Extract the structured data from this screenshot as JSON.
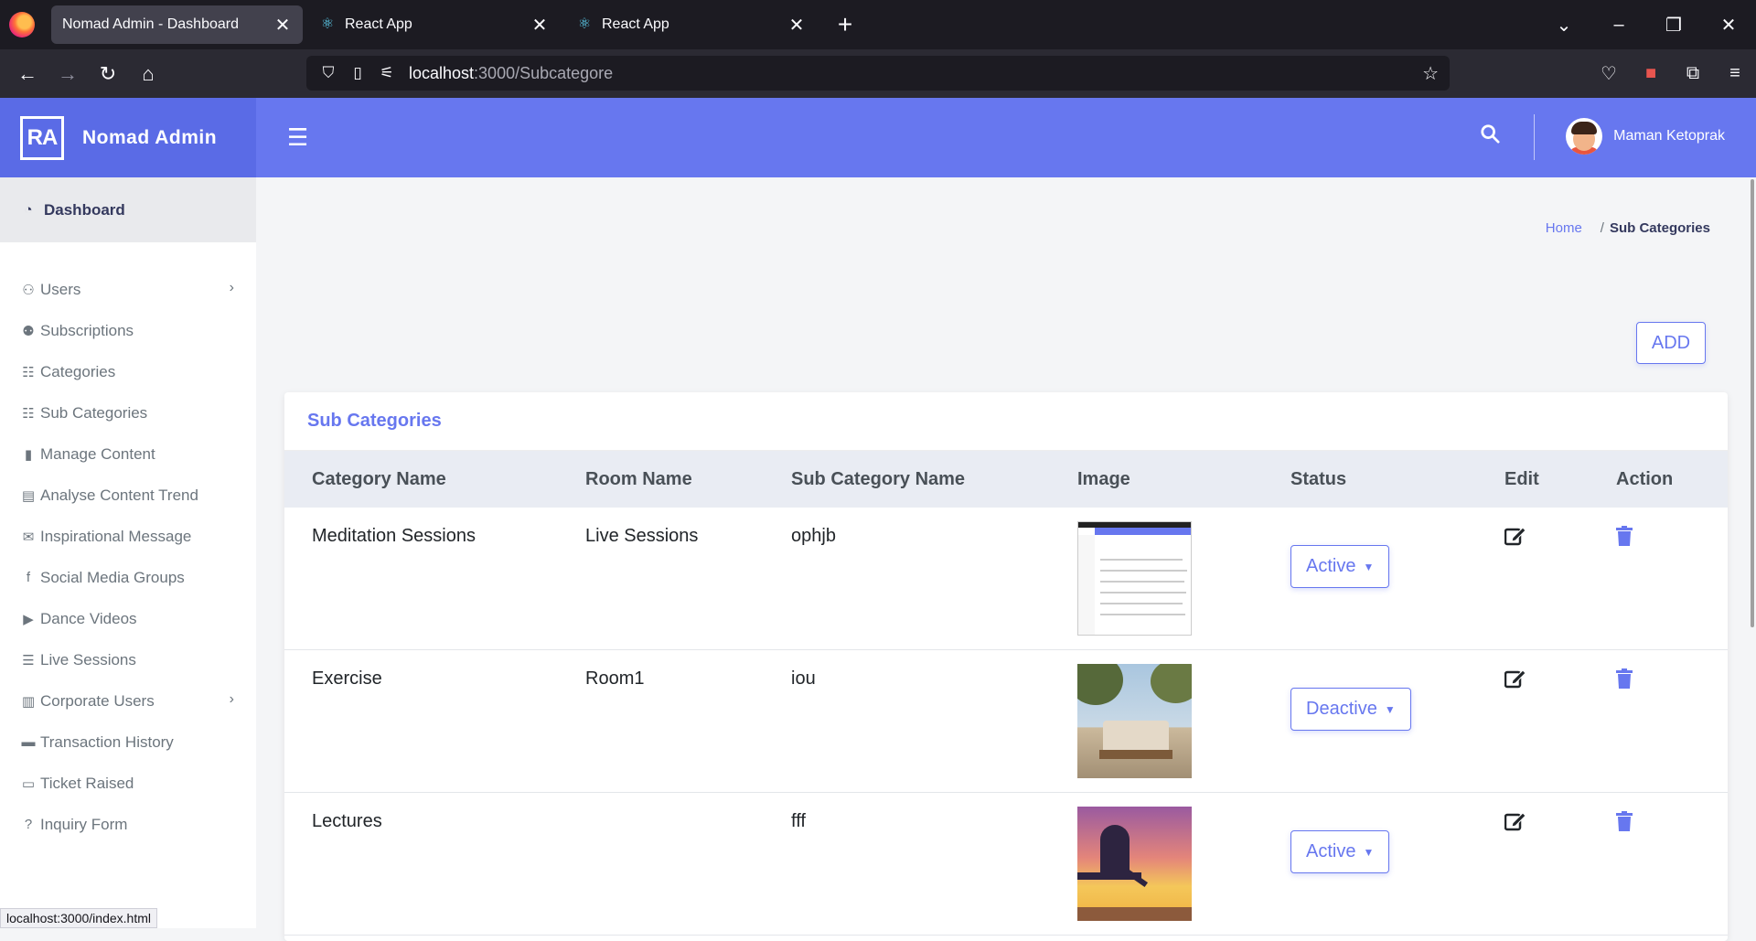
{
  "browser": {
    "tabs": [
      {
        "title": "Nomad Admin - Dashboard",
        "active": true
      },
      {
        "title": "React App",
        "active": false
      },
      {
        "title": "React App",
        "active": false
      }
    ],
    "url_host": "localhost",
    "url_path": ":3000/Subcategore",
    "status_url": "localhost:3000/index.html"
  },
  "header": {
    "logo_text": "RA",
    "brand": "Nomad Admin",
    "user_name": "Maman Ketoprak",
    "accent_color": "#6777ef"
  },
  "sidebar": {
    "dashboard": "Dashboard",
    "items": [
      {
        "label": "Users",
        "icon": "user-icon",
        "has_submenu": true
      },
      {
        "label": "Subscriptions",
        "icon": "user-plus-icon",
        "has_submenu": false
      },
      {
        "label": "Categories",
        "icon": "list-icon",
        "has_submenu": false
      },
      {
        "label": "Sub Categories",
        "icon": "list-icon",
        "has_submenu": false
      },
      {
        "label": "Manage Content",
        "icon": "file-icon",
        "has_submenu": false
      },
      {
        "label": "Analyse Content Trend",
        "icon": "keyboard-icon",
        "has_submenu": false
      },
      {
        "label": "Inspirational Message",
        "icon": "envelope-icon",
        "has_submenu": false
      },
      {
        "label": "Social Media Groups",
        "icon": "facebook-icon",
        "has_submenu": false
      },
      {
        "label": "Dance Videos",
        "icon": "play-circle-icon",
        "has_submenu": false
      },
      {
        "label": "Live Sessions",
        "icon": "bars-icon",
        "has_submenu": false
      },
      {
        "label": "Corporate Users",
        "icon": "building-icon",
        "has_submenu": true
      },
      {
        "label": "Transaction History",
        "icon": "credit-card-icon",
        "has_submenu": false
      },
      {
        "label": "Ticket Raised",
        "icon": "ticket-icon",
        "has_submenu": false
      },
      {
        "label": "Inquiry Form",
        "icon": "question-circle-icon",
        "has_submenu": false
      }
    ]
  },
  "breadcrumb": {
    "home": "Home",
    "separator": "/",
    "current": "Sub Categories"
  },
  "add_button": "ADD",
  "card": {
    "title": "Sub Categories",
    "columns": [
      "Category Name",
      "Room Name",
      "Sub Category Name",
      "Image",
      "Status",
      "Edit",
      "Action"
    ],
    "rows": [
      {
        "category": "Meditation Sessions",
        "room": "Live Sessions",
        "sub_category": "ophjb",
        "image": "screenshot-thumbnail",
        "status": "Active"
      },
      {
        "category": "Exercise",
        "room": "Room1",
        "sub_category": "iou",
        "image": "sofa-thumbnail",
        "status": "Deactive"
      },
      {
        "category": "Lectures",
        "room": "",
        "sub_category": "fff",
        "image": "sunset-thumbnail",
        "status": "Active"
      }
    ]
  }
}
